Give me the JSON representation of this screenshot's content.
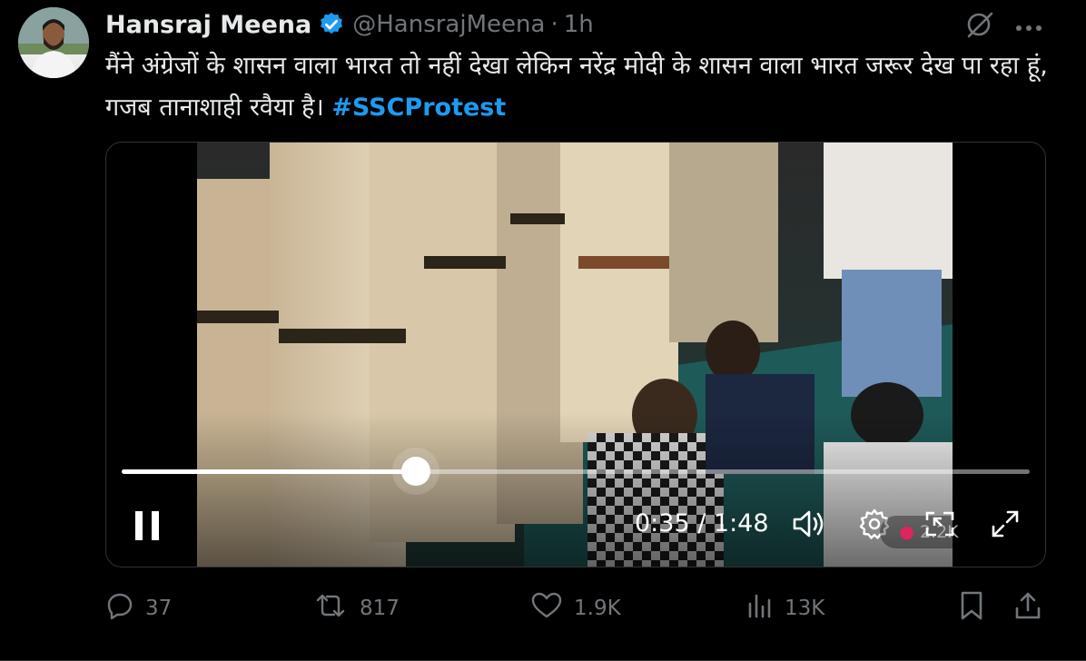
{
  "tweet": {
    "author_name": "Hansraj Meena",
    "handle": "@HansrajMeena",
    "separator": "·",
    "time": "1h",
    "text": "मैंने अंग्रेजों के शासन वाला भारत तो नहीं देखा लेकिन नरेंद्र मोदी के शासन वाला भारत जरूर देख पा रहा हूं, गजब तानाशाही रवैया है। ",
    "hashtag": "#SSCProtest"
  },
  "video": {
    "current_time": "0:35",
    "duration": "1:48",
    "time_display": "0:35 / 1:48",
    "progress_fraction": 0.324,
    "views_pill": "2.2K"
  },
  "actions": {
    "replies": "37",
    "reposts": "817",
    "likes": "1.9K",
    "views": "13K"
  },
  "icons": {
    "verified": "verified-badge-icon",
    "grok": "grok-icon",
    "more": "more-icon",
    "reply": "reply-icon",
    "repost": "repost-icon",
    "like": "heart-icon",
    "views": "views-icon",
    "bookmark": "bookmark-icon",
    "share": "share-icon",
    "pause": "pause-icon",
    "volume": "volume-icon",
    "settings": "settings-icon",
    "pip": "picture-in-picture-icon",
    "fullscreen": "fullscreen-icon"
  },
  "colors": {
    "background": "#000000",
    "text": "#e7e9ea",
    "secondary": "#71767b",
    "accent": "#1d9bf0",
    "border": "#2f3336"
  }
}
